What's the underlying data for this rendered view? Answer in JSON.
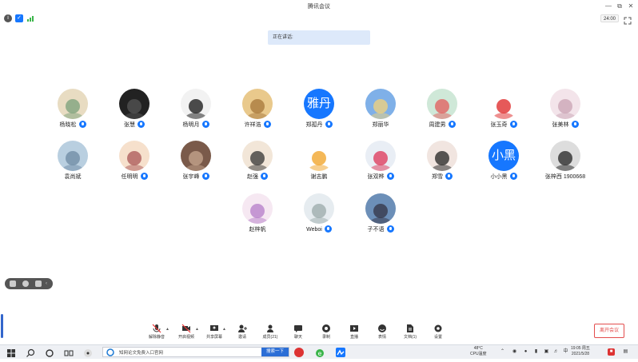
{
  "window": {
    "title": "腾讯会议",
    "timer": "24:00"
  },
  "speaking_label": "正在讲话:",
  "participants": [
    {
      "name": "杨晓松",
      "mic": "on",
      "avatar": "photo",
      "bg": "#e8dcc2",
      "fg": "#7aa07a"
    },
    {
      "name": "张慧",
      "mic": "on",
      "avatar": "photo",
      "bg": "#222",
      "fg": "#555"
    },
    {
      "name": "杨明月",
      "mic": "on",
      "avatar": "photo",
      "bg": "#f2f2f2",
      "fg": "#111"
    },
    {
      "name": "许祥浩",
      "mic": "on",
      "avatar": "photo",
      "bg": "#e9c98c",
      "fg": "#a6763a"
    },
    {
      "name": "郑孤丹",
      "mic": "on",
      "avatar": "text",
      "text": "雅丹"
    },
    {
      "name": "郑丽华",
      "mic": "none",
      "avatar": "photo",
      "bg": "#7fb0e8",
      "fg": "#f4d37a"
    },
    {
      "name": "周建男",
      "mic": "on",
      "avatar": "photo",
      "bg": "#cfe8d8",
      "fg": "#e35b5b"
    },
    {
      "name": "张玉奇",
      "mic": "on",
      "avatar": "photo",
      "bg": "#fff",
      "fg": "#d22"
    },
    {
      "name": "张美林",
      "mic": "on",
      "avatar": "photo",
      "bg": "#f3e4ea",
      "fg": "#c9a3b3"
    },
    {
      "name": "袁尚斌",
      "mic": "none",
      "avatar": "photo",
      "bg": "#b9cfe0",
      "fg": "#6d8aa3"
    },
    {
      "name": "任明明",
      "mic": "on",
      "avatar": "photo",
      "bg": "#f6e0cc",
      "fg": "#a55"
    },
    {
      "name": "张宇峰",
      "mic": "on",
      "avatar": "photo",
      "bg": "#7a5a4a",
      "fg": "#c8a890"
    },
    {
      "name": "赵强",
      "mic": "on",
      "avatar": "photo",
      "bg": "#f2e6d8",
      "fg": "#333"
    },
    {
      "name": "谢志鹏",
      "mic": "none",
      "avatar": "photo",
      "bg": "#fff",
      "fg": "#f0a020"
    },
    {
      "name": "张双桦",
      "mic": "on",
      "avatar": "photo",
      "bg": "#e9eef5",
      "fg": "#d35"
    },
    {
      "name": "郑雪",
      "mic": "on",
      "avatar": "photo",
      "bg": "#f1e5e0",
      "fg": "#222"
    },
    {
      "name": "小小黑",
      "mic": "on",
      "avatar": "text",
      "text": "小黑"
    },
    {
      "name": "张梓西 1900668",
      "mic": "none",
      "avatar": "photo",
      "bg": "#ddd",
      "fg": "#222"
    },
    {
      "name": "赵梓帆",
      "mic": "none",
      "avatar": "photo",
      "bg": "#f6e8f2",
      "fg": "#b47cc8"
    },
    {
      "name": "Weboi",
      "mic": "on",
      "avatar": "photo",
      "bg": "#e6ecf0",
      "fg": "#9aa"
    },
    {
      "name": "子不语",
      "mic": "on",
      "avatar": "photo",
      "bg": "#6c8fb8",
      "fg": "#334"
    }
  ],
  "toolbar": [
    {
      "label": "解除静音",
      "icon": "mic-muted-icon"
    },
    {
      "label": "开启视频",
      "icon": "video-off-icon"
    },
    {
      "label": "共享屏幕",
      "icon": "share-screen-icon"
    },
    {
      "label": "邀请",
      "icon": "invite-icon"
    },
    {
      "label": "成员(21)",
      "icon": "members-icon"
    },
    {
      "label": "聊天",
      "icon": "chat-icon"
    },
    {
      "label": "录制",
      "icon": "record-icon"
    },
    {
      "label": "直播",
      "icon": "live-icon"
    },
    {
      "label": "表情",
      "icon": "emoji-icon"
    },
    {
      "label": "文档(1)",
      "icon": "document-icon"
    },
    {
      "label": "设置",
      "icon": "settings-icon"
    }
  ],
  "leave_label": "离开会议",
  "taskbar": {
    "search_text": "知网论文免费入口官网",
    "search_button": "搜索一下",
    "weather_temp": "48°C",
    "weather_desc": "CPU温度",
    "time": "19:05 周五",
    "date": "2021/5/28",
    "ime": "中"
  }
}
